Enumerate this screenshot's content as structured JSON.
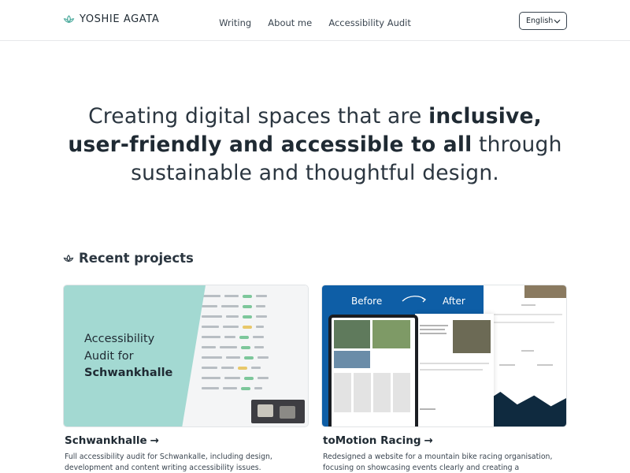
{
  "header": {
    "logo_text": "YOSHIE AGATA",
    "nav": [
      "Writing",
      "About me",
      "Accessibility Audit"
    ],
    "language": "English"
  },
  "hero": {
    "part1": "Creating digital spaces that are ",
    "bold1": "inclusive,",
    "bold2": "user-friendly and accessible to all",
    "part2": " through",
    "part3": "sustainable and thoughtful design."
  },
  "projects": {
    "title": "Recent projects",
    "items": [
      {
        "title": "Schwankhalle",
        "arrow": "→",
        "description": "Full accessibility audit for Schwankalle, including design, development and content writing accessibility issues.",
        "thumb_line1": "Accessibility",
        "thumb_line2": "Audit for",
        "thumb_line3": "Schwankhalle"
      },
      {
        "title": "toMotion Racing",
        "arrow": "→",
        "description": "Redesigned a website for a mountain bike racing organisation, focusing on showcasing events clearly and creating a streamlined",
        "thumb_before": "Before",
        "thumb_after": "After"
      }
    ]
  },
  "colors": {
    "teal": "#a3d9d2",
    "blue": "#0e5ea6",
    "text": "#1f2a33"
  },
  "icons": {
    "logo": "lotus-icon",
    "section": "lotus-icon",
    "language": "chevron-down-icon"
  }
}
